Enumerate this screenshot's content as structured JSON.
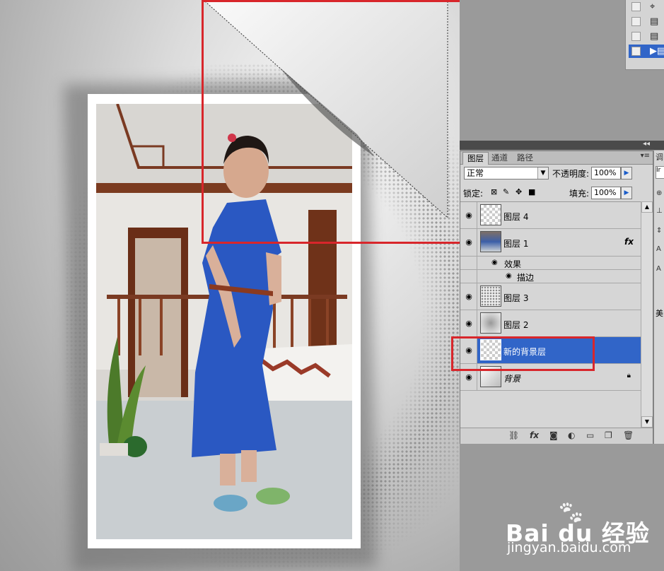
{
  "layers_panel": {
    "tabs": [
      {
        "label": "图层"
      },
      {
        "label": "通道"
      },
      {
        "label": "路径"
      }
    ],
    "side_tab_label": "调",
    "blend_mode": "正常",
    "opacity_label": "不透明度:",
    "opacity_value": "100%",
    "lock_label": "锁定:",
    "fill_label": "填充:",
    "fill_value": "100%",
    "effects_label": "效果",
    "stroke_label": "描边",
    "fx_label": "fx",
    "layers": [
      {
        "name": "图层 4",
        "visible": true,
        "selected": false
      },
      {
        "name": "图层 1",
        "visible": true,
        "selected": false,
        "has_effects": true
      },
      {
        "name": "图层 3",
        "visible": true,
        "selected": false
      },
      {
        "name": "图层 2",
        "visible": true,
        "selected": false
      },
      {
        "name": "新的背景层",
        "visible": true,
        "selected": true
      },
      {
        "name": "背景",
        "visible": true,
        "selected": false,
        "locked": true
      }
    ],
    "footer_icons": [
      "link-icon",
      "fx-icon",
      "mask-icon",
      "adjustment-icon",
      "group-icon",
      "new-layer-icon",
      "trash-icon"
    ]
  },
  "side_strip": {
    "value_label": "Ir",
    "bottom_label": "美"
  },
  "watermark": {
    "logo": "Bai du 经验",
    "url": "jingyan.baidu.com"
  },
  "colors": {
    "selection": "#3165c8",
    "annotation_red": "#d8262b"
  }
}
